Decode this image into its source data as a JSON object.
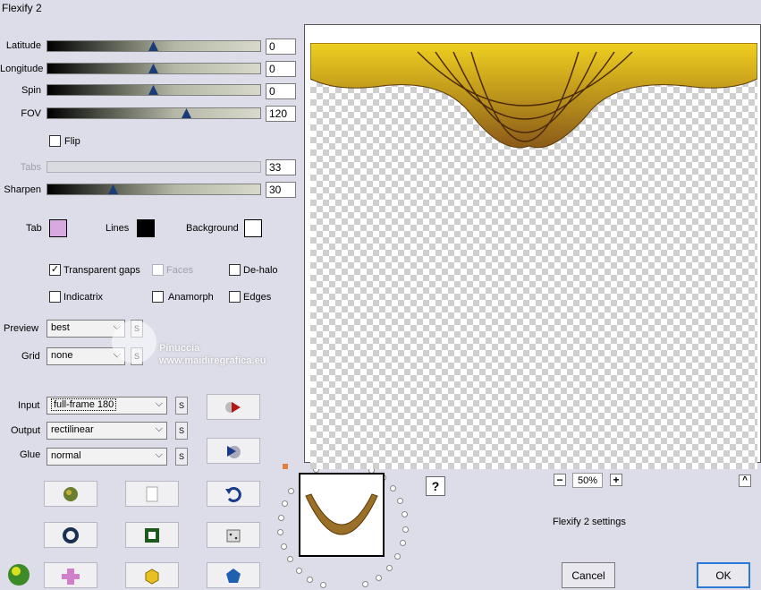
{
  "window": {
    "title": "Flexify 2"
  },
  "sliders": [
    {
      "label": "Latitude",
      "value": "0",
      "pos": 0.5,
      "enabled": true
    },
    {
      "label": "Longitude",
      "value": "0",
      "pos": 0.5,
      "enabled": true
    },
    {
      "label": "Spin",
      "value": "0",
      "pos": 0.5,
      "enabled": true
    },
    {
      "label": "FOV",
      "value": "120",
      "pos": 0.65,
      "enabled": true
    },
    {
      "label": "Tabs",
      "value": "33",
      "pos": 0.0,
      "enabled": false
    },
    {
      "label": "Sharpen",
      "value": "30",
      "pos": 0.3,
      "enabled": true
    }
  ],
  "flip": {
    "label": "Flip",
    "checked": false
  },
  "colors": {
    "tab": {
      "label": "Tab",
      "color": "#d8a8e0"
    },
    "lines": {
      "label": "Lines",
      "color": "#000000"
    },
    "background": {
      "label": "Background",
      "color": "#ffffff"
    }
  },
  "options": {
    "transparent_gaps": {
      "label": "Transparent gaps",
      "checked": true
    },
    "faces": {
      "label": "Faces",
      "checked": false,
      "enabled": false
    },
    "de_halo": {
      "label": "De-halo",
      "checked": false
    },
    "indicatrix": {
      "label": "Indicatrix",
      "checked": false
    },
    "anamorph": {
      "label": "Anamorph",
      "checked": false
    },
    "edges": {
      "label": "Edges",
      "checked": false
    }
  },
  "preview_quality": {
    "label": "Preview",
    "value": "best"
  },
  "grid": {
    "label": "Grid",
    "value": "none"
  },
  "watermark": {
    "name": "Pinuccia",
    "url": "www.maidiregrafica.eu"
  },
  "input": {
    "label": "Input",
    "value": "full-frame 180"
  },
  "output": {
    "label": "Output",
    "value": "rectilinear"
  },
  "glue": {
    "label": "Glue",
    "value": "normal"
  },
  "s_label": "S",
  "zoom": {
    "minus": "−",
    "value": "50%",
    "plus": "+"
  },
  "help_label": "?",
  "collapse_label": "^",
  "status": "Flexify 2 settings",
  "buttons": {
    "cancel": "Cancel",
    "ok": "OK"
  }
}
